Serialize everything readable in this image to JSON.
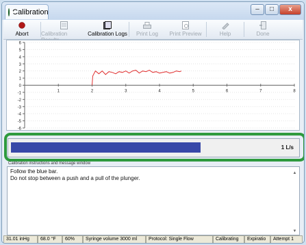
{
  "window": {
    "title": "Calibration",
    "controls": [
      "–",
      "□",
      "x"
    ]
  },
  "toolbar": {
    "abort": "Abort",
    "results": "Calibration Results",
    "logs": "Calibration Logs",
    "print_log": "Print Log",
    "print_preview": "Print Preview",
    "help": "Help",
    "done": "Done"
  },
  "chart_data": {
    "type": "line",
    "x_ticks": [
      "1",
      "2",
      "3",
      "4",
      "5",
      "6",
      "7",
      "8"
    ],
    "y_ticks": [
      "6",
      "5",
      "4",
      "3",
      "2",
      "1",
      "0",
      "-1",
      "-2",
      "-3",
      "-4",
      "-5",
      "-6"
    ],
    "xlim": [
      0,
      8
    ],
    "ylim": [
      -6,
      6
    ],
    "series": [
      {
        "color": "#e03030",
        "x": [
          2.0,
          2.02,
          2.1,
          2.2,
          2.3,
          2.4,
          2.5,
          2.6,
          2.7,
          2.8,
          2.9,
          3.0,
          3.1,
          3.2,
          3.3,
          3.4,
          3.5,
          3.6,
          3.7,
          3.8,
          3.9,
          4.0,
          4.1,
          4.2,
          4.3,
          4.4,
          4.5,
          4.6,
          4.65
        ],
        "y": [
          0.0,
          1.3,
          2.0,
          1.6,
          2.0,
          1.5,
          1.9,
          1.8,
          1.6,
          1.9,
          1.8,
          2.0,
          1.7,
          2.0,
          2.1,
          1.7,
          2.0,
          1.9,
          2.1,
          1.8,
          1.9,
          1.7,
          1.8,
          1.9,
          1.7,
          1.8,
          2.0,
          1.9,
          2.0
        ]
      }
    ]
  },
  "progress": {
    "fraction": 0.66,
    "flow_label": "1 L/s"
  },
  "messages": {
    "caption": "Calibration instructions and message window",
    "lines": [
      "Follow the blue bar.",
      "Do not stop between a push and a pull of the plunger."
    ]
  },
  "status": {
    "pressure": "31.01 inHg",
    "temperature": "68.0 °F",
    "humidity": "60%",
    "syringe": "Syringe volume 3000 ml",
    "protocol": "Protocol: Single Flow",
    "state": "Calibrating",
    "phase": "Expiratio",
    "attempt": "Attempt 1"
  },
  "colors": {
    "highlight": "#2e9a3e",
    "bar": "#3848a8",
    "trace": "#e03030"
  }
}
